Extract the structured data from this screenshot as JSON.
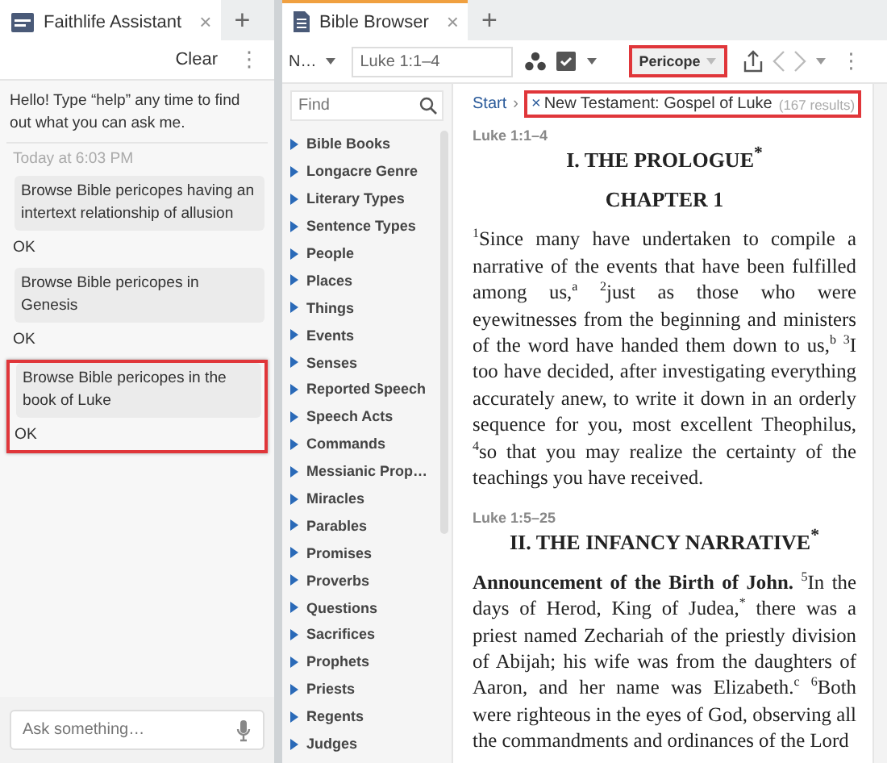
{
  "assistant": {
    "tab": {
      "title": "Faithlife Assistant",
      "close": "×",
      "add": "+"
    },
    "toolbar": {
      "clear": "Clear",
      "more": "⋮"
    },
    "greeting": "Hello! Type “help” any time to find out what you can ask me.",
    "timestamp": "Today at 6:03 PM",
    "exchanges": [
      {
        "query": "Browse Bible pericopes having an intertext relationship of allusion",
        "reply": "OK",
        "highlighted": false
      },
      {
        "query": "Browse Bible pericopes in Genesis",
        "reply": "OK",
        "highlighted": false
      },
      {
        "query": "Browse Bible pericopes in the book of Luke",
        "reply": "OK",
        "highlighted": true
      }
    ],
    "input": {
      "placeholder": "Ask something…"
    }
  },
  "browser": {
    "tab": {
      "title": "Bible Browser",
      "close": "×",
      "add": "+"
    },
    "toolbar": {
      "version": "N…",
      "reference": "Luke 1:1–4",
      "mode": {
        "label": "Pericope",
        "highlighted": true
      },
      "more": "⋮"
    },
    "sidebar": {
      "find_placeholder": "Find",
      "items": [
        "Bible Books",
        "Longacre Genre",
        "Literary Types",
        "Sentence Types",
        "People",
        "Places",
        "Things",
        "Events",
        "Senses",
        "Reported Speech",
        "Speech Acts",
        "Commands",
        "Messianic Prop…",
        "Miracles",
        "Parables",
        "Promises",
        "Proverbs",
        "Questions",
        "Sacrifices",
        "Prophets",
        "Priests",
        "Regents",
        "Judges"
      ]
    },
    "breadcrumb": {
      "start": "Start",
      "separator": "›",
      "remove": "×",
      "filter": "New Testament: Gospel of Luke",
      "count": "(167 results)",
      "highlighted": true
    },
    "sections": [
      {
        "reference": "Luke 1:1–4",
        "heading": "I. THE PROLOGUE$^{*}$",
        "subheading": "CHAPTER 1",
        "text": "$^{1}$Since many have undertaken to compile a narrative of the events that have been fulfilled among us,$^{a}$ $^{2}$just as those who were eyewitnesses from the beginning and ministers of the word have handed them down to us,$^{b}$ $^{3}$I too have decided, after investigating everything accurately anew, to write it down in an orderly sequence for you, most excellent Theophilus, $^{4}$so that you may realize the certainty of the teachings you have received."
      },
      {
        "reference": "Luke 1:5–25",
        "heading": "II. THE INFANCY NARRATIVE$^{*}$",
        "text": "**Announcement of the Birth of John.** $^{5}$In the days of Herod, King of Judea,$^{*}$ there was a priest named Zechariah of the priestly division of Abijah; his wife was from the daughters of Aaron, and her name was Elizabeth.$^{c}$ $^{6}$Both were righteous in the eyes of God, observing all the commandments and ordinances of the Lord"
      }
    ]
  }
}
